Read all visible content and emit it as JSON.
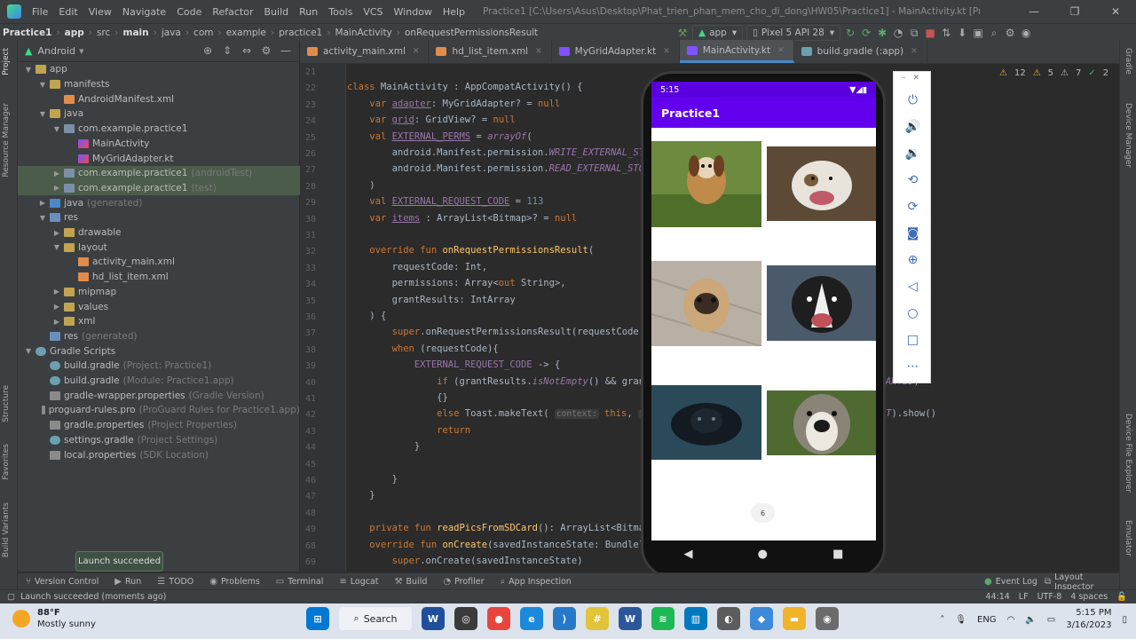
{
  "window": {
    "menu": [
      "File",
      "Edit",
      "View",
      "Navigate",
      "Code",
      "Refactor",
      "Build",
      "Run",
      "Tools",
      "VCS",
      "Window",
      "Help"
    ],
    "title": "Practice1 [C:\\Users\\Asus\\Desktop\\Phat_trien_phan_mem_cho_di_dong\\HW05\\Practice1] - MainActivity.kt [Practice1.app.main]"
  },
  "breadcrumb": [
    "Practice1",
    "app",
    "src",
    "main",
    "java",
    "com",
    "example",
    "practice1",
    "MainActivity",
    "onRequestPermissionsResult"
  ],
  "toolbar": {
    "run_config": "app",
    "device": "Pixel 5 API 28"
  },
  "left_strip": [
    "Project",
    "Resource Manager",
    "Structure",
    "Favorites",
    "Build Variants"
  ],
  "right_strip": [
    "Gradle",
    "Device Manager",
    "Device File Explorer",
    "Emulator"
  ],
  "project": {
    "view": "Android",
    "tree": [
      {
        "label": "app",
        "hint": "",
        "icon": "folder",
        "level": 0,
        "open": true
      },
      {
        "label": "manifests",
        "hint": "",
        "icon": "folder",
        "level": 1,
        "open": true
      },
      {
        "label": "AndroidManifest.xml",
        "hint": "",
        "icon": "xml",
        "level": 2,
        "open": null
      },
      {
        "label": "java",
        "hint": "",
        "icon": "folder",
        "level": 1,
        "open": true
      },
      {
        "label": "com.example.practice1",
        "hint": "",
        "icon": "pkg",
        "level": 2,
        "open": true
      },
      {
        "label": "MainActivity",
        "hint": "",
        "icon": "kt",
        "level": 3,
        "open": null
      },
      {
        "label": "MyGridAdapter.kt",
        "hint": "",
        "icon": "kt",
        "level": 3,
        "open": null
      },
      {
        "label": "com.example.practice1",
        "hint": "(androidTest)",
        "icon": "pkg",
        "level": 2,
        "open": false,
        "sel": true
      },
      {
        "label": "com.example.practice1",
        "hint": "(test)",
        "icon": "pkg",
        "level": 2,
        "open": false,
        "sel": true
      },
      {
        "label": "java",
        "hint": "(generated)",
        "icon": "java",
        "level": 1,
        "open": false
      },
      {
        "label": "res",
        "hint": "",
        "icon": "res",
        "level": 1,
        "open": true
      },
      {
        "label": "drawable",
        "hint": "",
        "icon": "folder",
        "level": 2,
        "open": false
      },
      {
        "label": "layout",
        "hint": "",
        "icon": "folder",
        "level": 2,
        "open": true
      },
      {
        "label": "activity_main.xml",
        "hint": "",
        "icon": "xml",
        "level": 3,
        "open": null
      },
      {
        "label": "hd_list_item.xml",
        "hint": "",
        "icon": "xml",
        "level": 3,
        "open": null
      },
      {
        "label": "mipmap",
        "hint": "",
        "icon": "folder",
        "level": 2,
        "open": false
      },
      {
        "label": "values",
        "hint": "",
        "icon": "folder",
        "level": 2,
        "open": false
      },
      {
        "label": "xml",
        "hint": "",
        "icon": "folder",
        "level": 2,
        "open": false
      },
      {
        "label": "res",
        "hint": "(generated)",
        "icon": "res",
        "level": 1,
        "open": null
      },
      {
        "label": "Gradle Scripts",
        "hint": "",
        "icon": "grad",
        "level": 0,
        "open": true
      },
      {
        "label": "build.gradle",
        "hint": "(Project: Practice1)",
        "icon": "grad",
        "level": 1,
        "open": null
      },
      {
        "label": "build.gradle",
        "hint": "(Module: Practice1.app)",
        "icon": "grad",
        "level": 1,
        "open": null
      },
      {
        "label": "gradle-wrapper.properties",
        "hint": "(Gradle Version)",
        "icon": "props",
        "level": 1,
        "open": null
      },
      {
        "label": "proguard-rules.pro",
        "hint": "(ProGuard Rules for Practice1.app)",
        "icon": "props",
        "level": 1,
        "open": null
      },
      {
        "label": "gradle.properties",
        "hint": "(Project Properties)",
        "icon": "props",
        "level": 1,
        "open": null
      },
      {
        "label": "settings.gradle",
        "hint": "(Project Settings)",
        "icon": "grad",
        "level": 1,
        "open": null
      },
      {
        "label": "local.properties",
        "hint": "(SDK Location)",
        "icon": "props",
        "level": 1,
        "open": null
      }
    ]
  },
  "tabs": [
    {
      "label": "activity_main.xml",
      "icon": "xml",
      "active": false
    },
    {
      "label": "hd_list_item.xml",
      "icon": "xml",
      "active": false
    },
    {
      "label": "MyGridAdapter.kt",
      "icon": "kt",
      "active": false
    },
    {
      "label": "MainActivity.kt",
      "icon": "kt",
      "active": true
    },
    {
      "label": "build.gradle (:app)",
      "icon": "grad",
      "active": false
    }
  ],
  "inspections": {
    "warn1": "12",
    "warn2": "5",
    "weak": "7",
    "typo": "2"
  },
  "code": [
    {
      "n": "21",
      "h": ""
    },
    {
      "n": "22",
      "h": "<span class='kw'>class</span> MainActivity : AppCompatActivity() {"
    },
    {
      "n": "23",
      "h": "    <span class='kw'>var</span> <span class='pr ul'>adapter</span>: MyGridAdapter? = <span class='kw'>null</span>"
    },
    {
      "n": "24",
      "h": "    <span class='kw'>var</span> <span class='pr ul'>grid</span>: GridView? = <span class='kw'>null</span>"
    },
    {
      "n": "25",
      "h": "    <span class='kw'>val</span> <span class='pr ul'>EXTERNAL_PERMS</span> = <span class='it'>arrayOf</span>("
    },
    {
      "n": "26",
      "h": "        android.Manifest.permission.<span class='it'>WRITE_EXTERNAL_STORAGE</span>,"
    },
    {
      "n": "27",
      "h": "        android.Manifest.permission.<span class='it'>READ_EXTERNAL_STORAGE</span>"
    },
    {
      "n": "28",
      "h": "    )"
    },
    {
      "n": "29",
      "h": "    <span class='kw'>val</span> <span class='pr ul'>EXTERNAL_REQUEST_CODE</span> = <span class='num'>113</span>"
    },
    {
      "n": "30",
      "h": "    <span class='kw'>var</span> <span class='pr ul'>items</span> : ArrayList&lt;Bitmap&gt;? = <span class='kw'>null</span>"
    },
    {
      "n": "31",
      "h": ""
    },
    {
      "n": "32",
      "h": "    <span class='kw'>override fun</span> <span class='fn'>onRequestPermissionsResult</span>("
    },
    {
      "n": "33",
      "h": "        requestCode: Int,"
    },
    {
      "n": "34",
      "h": "        permissions: Array&lt;<span class='kw'>out</span> String&gt;,"
    },
    {
      "n": "35",
      "h": "        grantResults: IntArray"
    },
    {
      "n": "36",
      "h": "    ) {"
    },
    {
      "n": "37",
      "h": "        <span class='kw'>super</span>.onRequestPermissionsResult(requestCode, permissions, grantResults)"
    },
    {
      "n": "38",
      "h": "        <span class='kw'>when</span> (requestCode){"
    },
    {
      "n": "39",
      "h": "            <span class='pr'>EXTERNAL_REQUEST_CODE</span> -&gt; {"
    },
    {
      "n": "40",
      "h": "                <span class='kw'>if</span> (grantResults.<span class='it'>isNotEmpty</span>() &amp;&amp; grantResults[<span class='num'>0</span>] == PackageManager.<span class='it'>PERMISSION_GRANTED</span>)"
    },
    {
      "n": "41",
      "h": "                {}"
    },
    {
      "n": "42",
      "h": "                <span class='kw'>else</span> Toast.makeText( <span class='hint2'>context:</span> <span class='kw'>this</span>, <span class='hint2'>text:</span> <span class='str'>\"Permission denied\"</span>, Toast.<span class='it'>LENGTH_SHORT</span>).show()"
    },
    {
      "n": "43",
      "h": "                <span class='kw'>return</span>"
    },
    {
      "n": "44",
      "h": "            }"
    },
    {
      "n": "45",
      "h": ""
    },
    {
      "n": "46",
      "h": "        }"
    },
    {
      "n": "47",
      "h": "    }"
    },
    {
      "n": "48",
      "h": ""
    },
    {
      "n": "49",
      "h": "    <span class='kw'>private fun</span> <span class='fn'>readPicsFromSDCard</span>(): ArrayList&lt;Bitmap&gt; {"
    },
    {
      "n": "68",
      "h": "    <span class='kw'>override fun</span> <span class='fn'>onCreate</span>(savedInstanceState: Bundle?) {"
    },
    {
      "n": "69",
      "h": "        <span class='kw'>super</span>.onCreate(savedInstanceState)"
    }
  ],
  "emulator": {
    "time": "5:15",
    "app_title": "Practice1",
    "scroll_indicator": "6"
  },
  "emu_controls": [
    "power-icon",
    "volume-up-icon",
    "volume-down-icon",
    "rotate-left-icon",
    "rotate-right-icon",
    "camera-icon",
    "zoom-icon",
    "back-icon",
    "home-icon",
    "overview-icon",
    "more-icon"
  ],
  "toast": "Launch succeeded",
  "bottom_tools": [
    "Version Control",
    "Run",
    "TODO",
    "Problems",
    "Terminal",
    "Logcat",
    "Build",
    "Profiler",
    "App Inspection"
  ],
  "bottom_right_tools": [
    "Event Log",
    "Layout Inspector"
  ],
  "status": {
    "message": "Launch succeeded (moments ago)",
    "pos": "44:14",
    "eol": "LF",
    "enc": "UTF-8",
    "indent": "4 spaces"
  },
  "taskbar": {
    "temp": "88°F",
    "condition": "Mostly sunny",
    "search": "Search",
    "lang": "ENG",
    "time": "5:15 PM",
    "date": "3/16/2023"
  }
}
